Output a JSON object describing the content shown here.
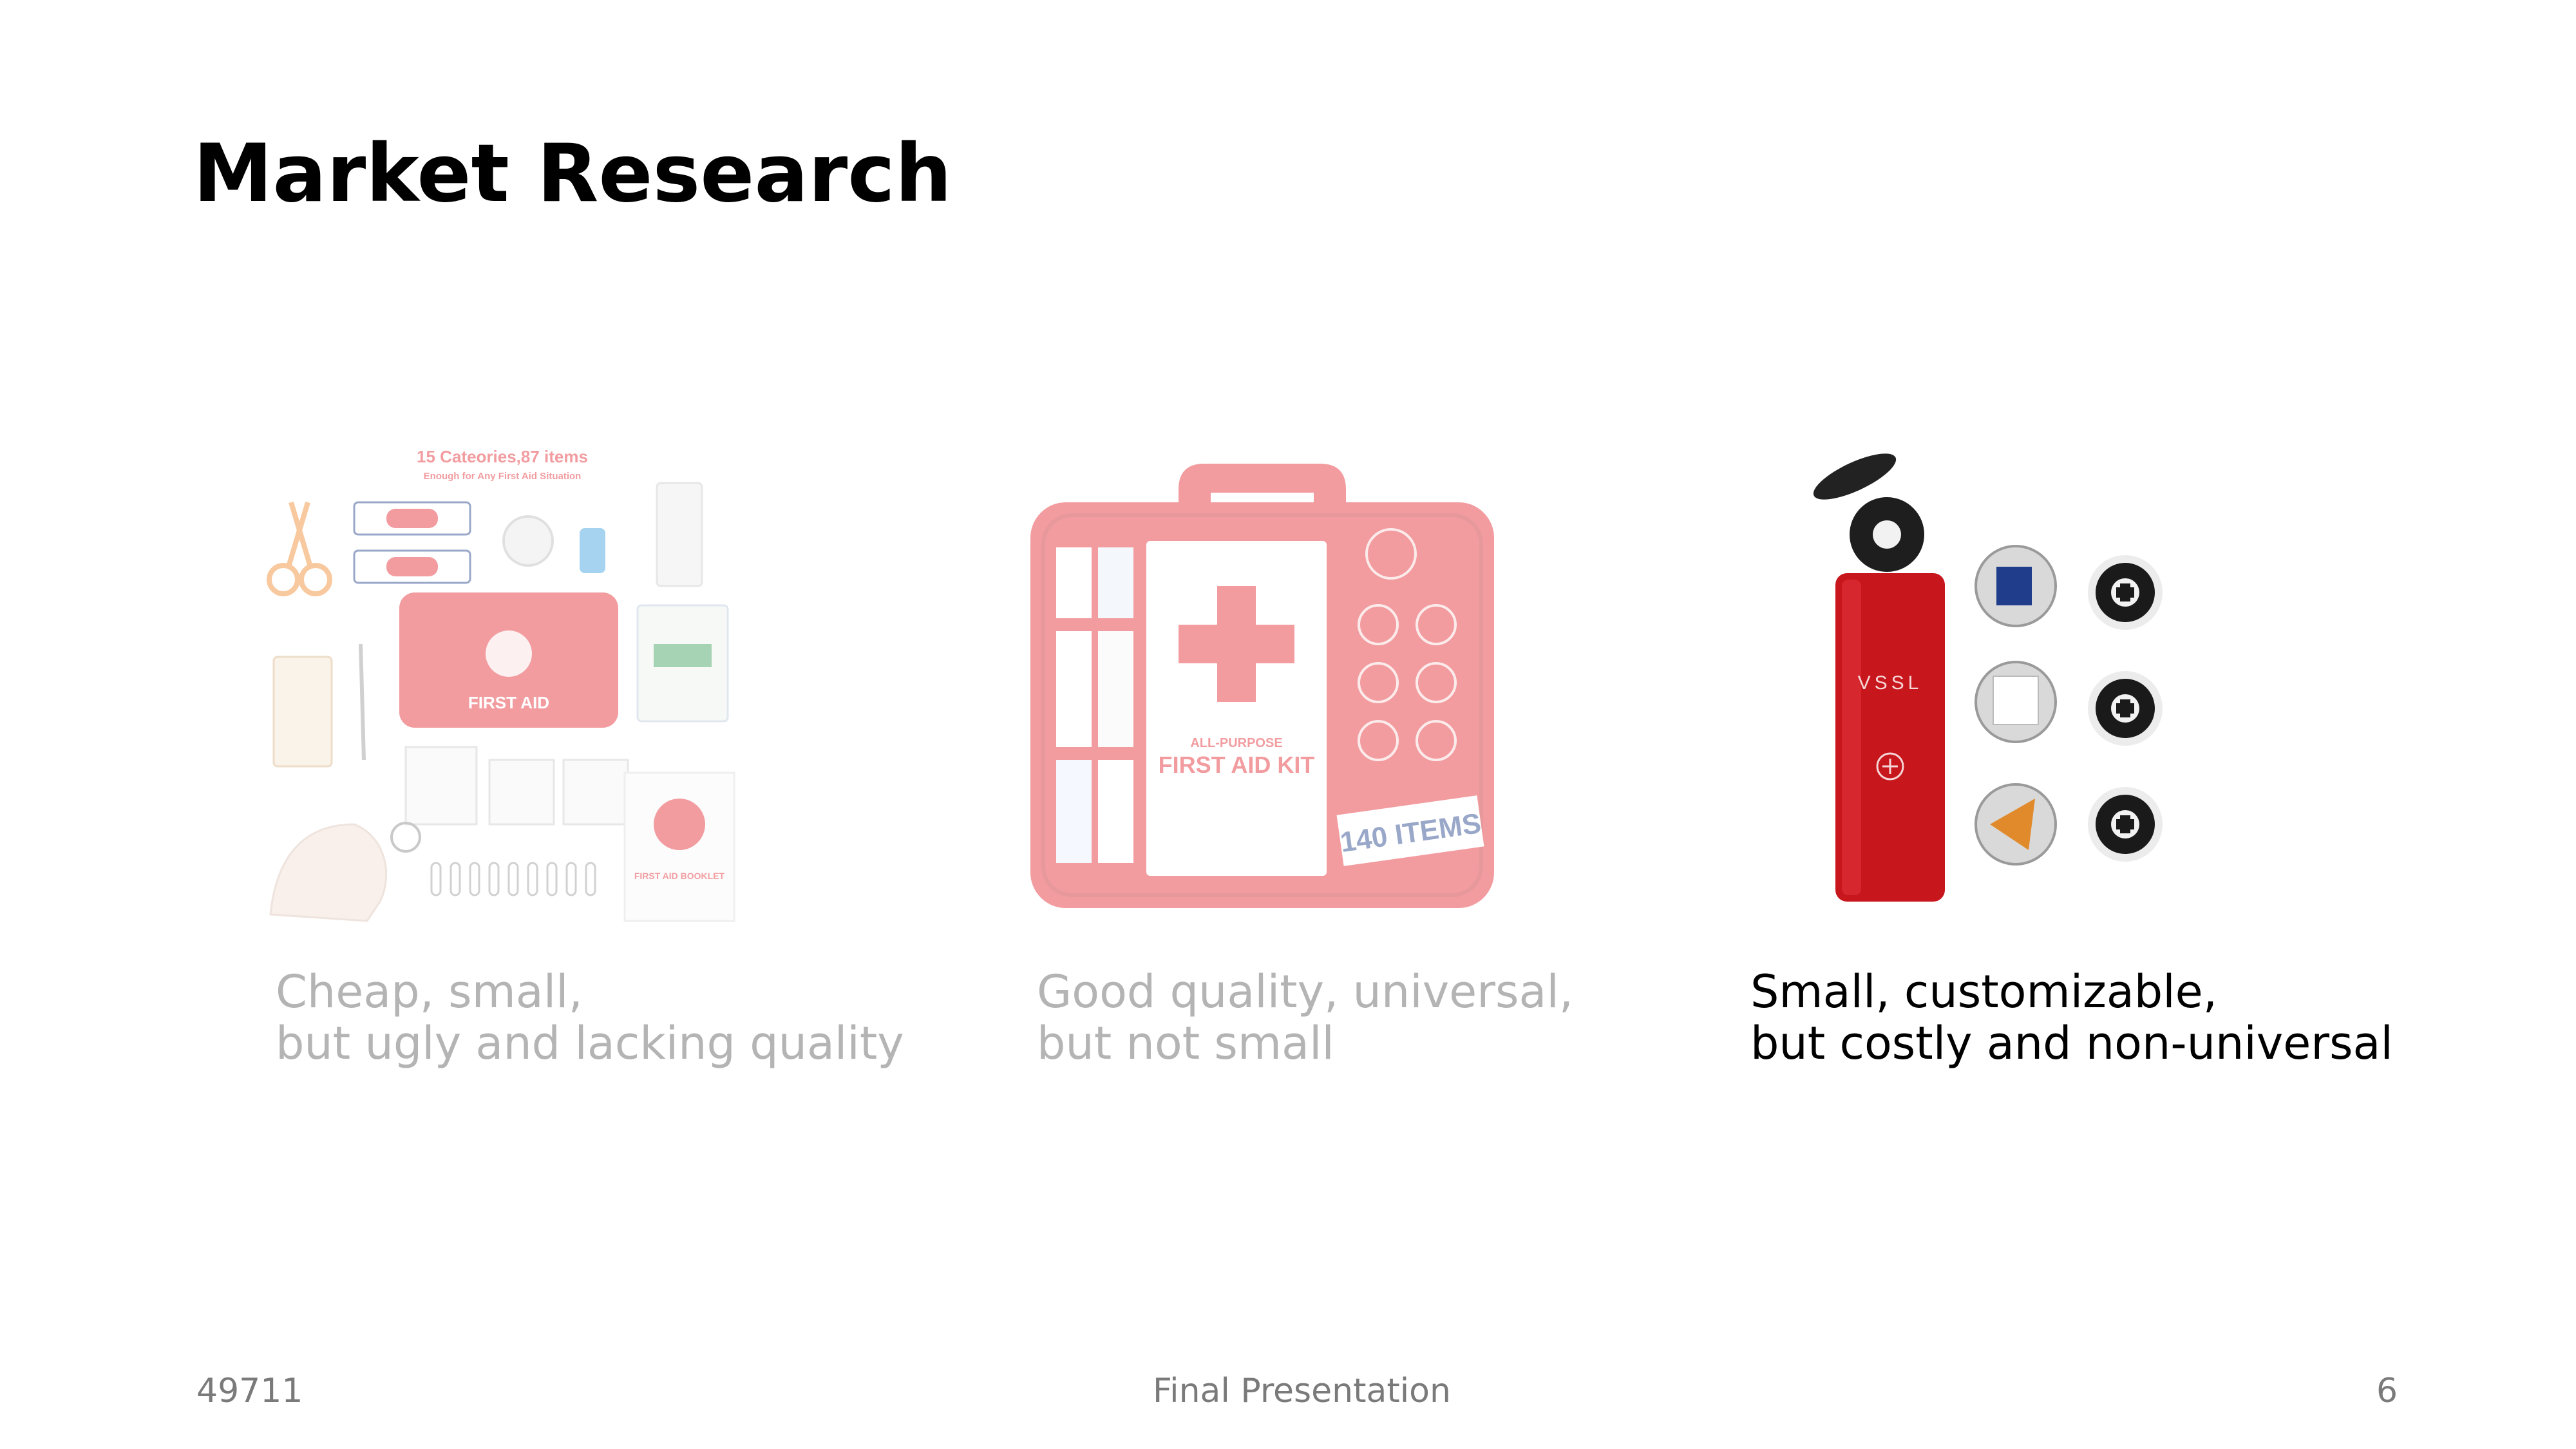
{
  "slide": {
    "title": "Market Research"
  },
  "products": [
    {
      "image_name": "budget-first-aid-pouch-kit",
      "image_text": {
        "headline": "15 Cateories,87 items",
        "subheadline": "Enough for Any First Aid Situation",
        "pouch_label": "FIRST AID",
        "booklet_label": "FIRST AID BOOKLET"
      },
      "caption_line1": "Cheap, small,",
      "caption_line2": "but ugly and lacking quality",
      "highlighted": false
    },
    {
      "image_name": "hard-case-first-aid-kit",
      "image_text": {
        "kit_label": "ALL-PURPOSE",
        "kit_name": "FIRST AID KIT",
        "items_badge": "140 ITEMS"
      },
      "caption_line1": "Good quality, universal,",
      "caption_line2": "but not small",
      "highlighted": false
    },
    {
      "image_name": "vssl-tube-first-aid-kit",
      "image_text": {
        "brand": "VSSL"
      },
      "caption_line1": "Small, customizable,",
      "caption_line2": "but costly and non-universal",
      "highlighted": true
    }
  ],
  "footer": {
    "left": "49711",
    "center": "Final Presentation",
    "page_number": "6"
  },
  "colors": {
    "kit_red": "#e4262e",
    "vssl_red": "#c8161d",
    "dim_text": "#b4b4b4",
    "footer_text": "#7a7a7a"
  }
}
